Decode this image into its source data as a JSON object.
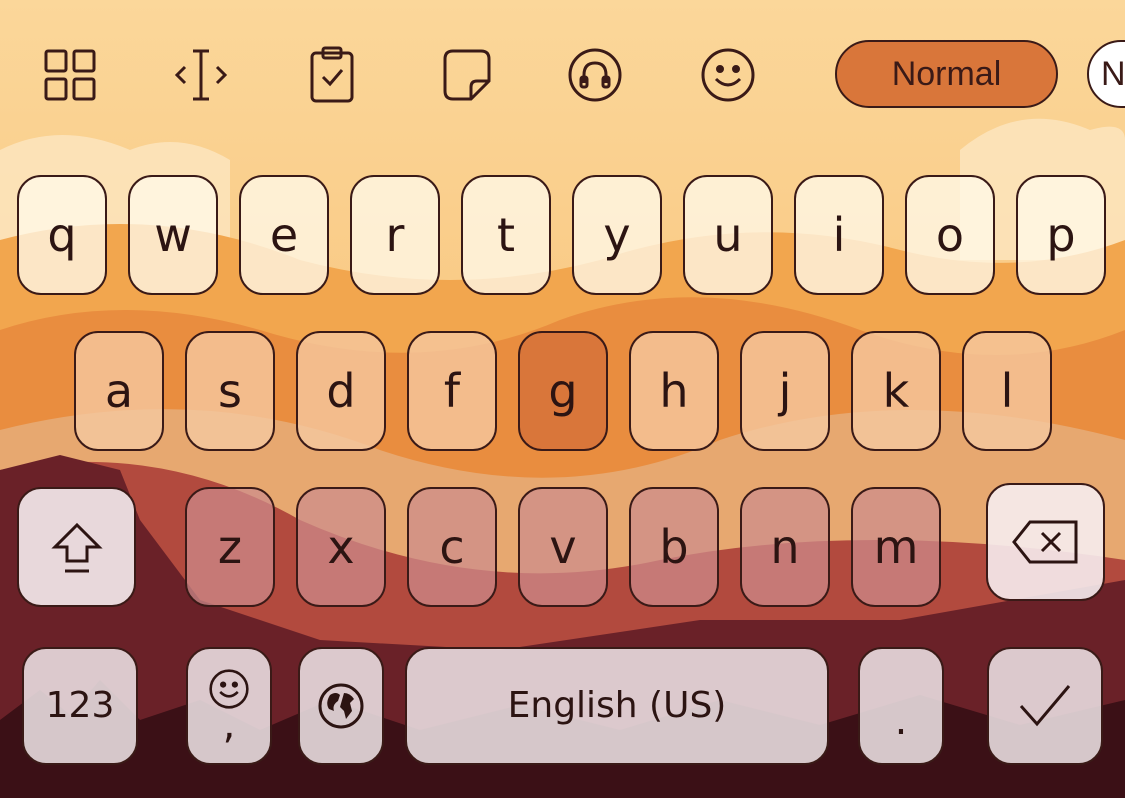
{
  "toolbar": {
    "icons": [
      "apps-grid-icon",
      "text-cursor-icon",
      "clipboard-icon",
      "sticky-note-icon",
      "headset-icon",
      "emoji-smile-icon"
    ],
    "mode_label": "Normal",
    "next_pill_label": "N",
    "accent_color": "#d9763a"
  },
  "keyboard": {
    "row1": [
      "q",
      "w",
      "e",
      "r",
      "t",
      "y",
      "u",
      "i",
      "o",
      "p"
    ],
    "row2": [
      "a",
      "s",
      "d",
      "f",
      "g",
      "h",
      "j",
      "k",
      "l"
    ],
    "row3": [
      "z",
      "x",
      "c",
      "v",
      "b",
      "n",
      "m"
    ],
    "active_key": "g",
    "numbers_label": "123",
    "comma_label": ",",
    "space_label": "English (US)",
    "period_label": "."
  }
}
